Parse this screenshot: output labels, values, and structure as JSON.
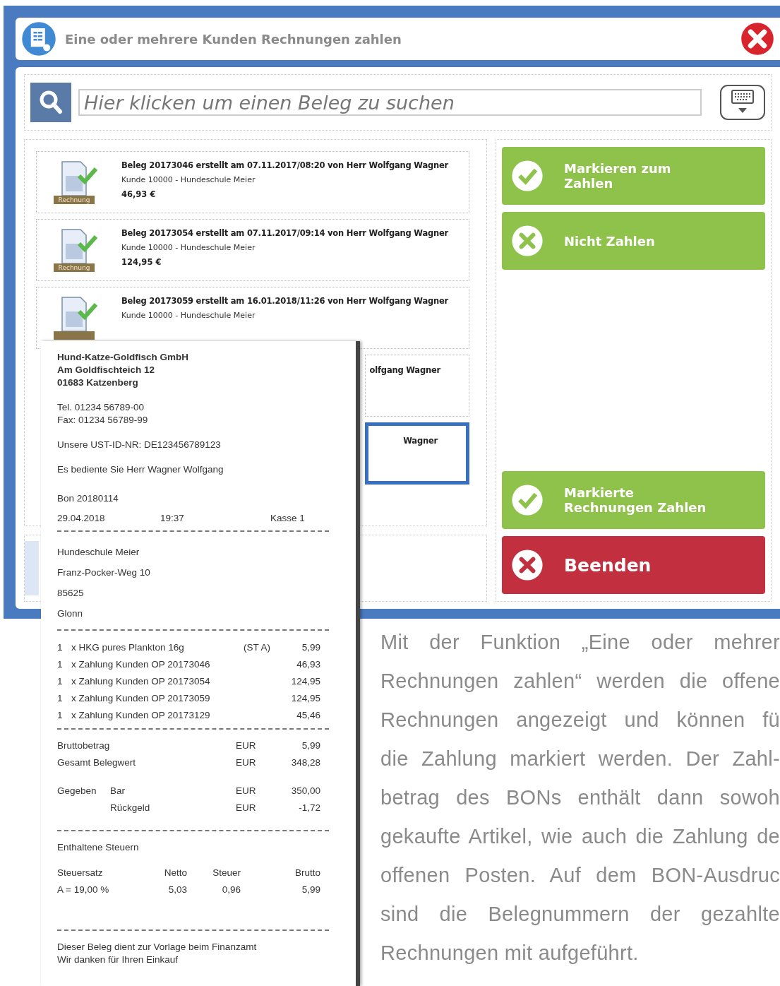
{
  "window": {
    "title": "Eine oder mehrere Kunden Rechnungen zahlen"
  },
  "search": {
    "placeholder": "Hier klicken um einen Beleg zu suchen"
  },
  "documents": [
    {
      "badge": "Rechnung",
      "title": "Beleg 20173046 erstellt am 07.11.2017/08:20 von Herr Wolfgang Wagner",
      "customer": "Kunde 10000 - Hundeschule Meier",
      "amount": "46,93 €",
      "selected": false,
      "kind": "full"
    },
    {
      "badge": "Rechnung",
      "title": "Beleg 20173054 erstellt am 07.11.2017/09:14 von Herr Wolfgang Wagner",
      "customer": "Kunde 10000 - Hundeschule Meier",
      "amount": "124,95 €",
      "selected": false,
      "kind": "full"
    },
    {
      "title": "Beleg 20173059 erstellt am 16.01.2018/11:26 von Herr Wolfgang Wagner",
      "customer": "Kunde 10000 - Hundeschule Meier",
      "selected": false,
      "kind": "full"
    },
    {
      "title": "olfgang Wagner",
      "selected": false,
      "kind": "partial"
    },
    {
      "title": "Wagner",
      "selected": true,
      "kind": "partial"
    }
  ],
  "actions_top": [
    {
      "kind": "mark",
      "label": "Markieren zum Zahlen"
    },
    {
      "kind": "unmark",
      "label": "Nicht Zahlen"
    }
  ],
  "actions_bottom": [
    {
      "kind": "pay",
      "label": "Markierte Rechnungen Zahlen"
    },
    {
      "kind": "quit",
      "label": "Beenden"
    }
  ],
  "receipt": [
    {
      "kind": "heading",
      "lines": [
        "Hund-Katze-Goldfisch GmbH",
        "Am Goldfischteich 12",
        "01683 Katzenberg"
      ]
    },
    {
      "kind": "text",
      "lines": [
        "Tel. 01234 56789-00",
        "Fax: 01234 56789-99"
      ]
    },
    {
      "kind": "text",
      "lines": [
        "Unsere UST-ID-NR: DE123456789123"
      ]
    },
    {
      "kind": "text",
      "lines": [
        "Es bediente Sie Herr Wagner Wolfgang"
      ]
    },
    {
      "kind": "spaced",
      "lines": [
        "Bon  20180114"
      ]
    },
    {
      "kind": "datetime",
      "date": "29.04.2018",
      "time": "19:37",
      "register": "Kasse 1"
    },
    {
      "kind": "divider"
    },
    {
      "kind": "spaced",
      "lines": [
        "Hundeschule Meier",
        "Franz-Pocker-Weg 10",
        "85625",
        "Glonn"
      ]
    },
    {
      "kind": "divider"
    },
    {
      "kind": "items",
      "rows": [
        {
          "qty": "1",
          "desc": "x HKG pures Plankton 16g",
          "tax": "(ST A)",
          "amount": "5,99"
        },
        {
          "qty": "1",
          "desc": "x Zahlung Kunden OP 20173046",
          "amount": "46,93"
        },
        {
          "qty": "1",
          "desc": "x Zahlung Kunden OP 20173054",
          "amount": "124,95"
        },
        {
          "qty": "1",
          "desc": "x Zahlung Kunden OP 20173059",
          "amount": "124,95"
        },
        {
          "qty": "1",
          "desc": "x Zahlung Kunden OP 20173129",
          "amount": "45,46"
        }
      ]
    },
    {
      "kind": "divider"
    },
    {
      "kind": "totals",
      "rows": [
        {
          "label": "Bruttobetrag",
          "currency": "EUR",
          "amount": "5,99"
        },
        {
          "label": "Gesamt Belegwert",
          "currency": "EUR",
          "amount": "348,28"
        }
      ]
    },
    {
      "kind": "totals",
      "rows": [
        {
          "label": "Gegeben",
          "sub": "Bar",
          "currency": "EUR",
          "amount": "350,00"
        },
        {
          "sub": "Rückgeld",
          "currency": "EUR",
          "amount": "-1,72"
        }
      ]
    },
    {
      "kind": "divider"
    },
    {
      "kind": "text",
      "lines": [
        "Enthaltene Steuern"
      ]
    },
    {
      "kind": "taxtable",
      "rows": [
        [
          "Steuersatz",
          "Netto",
          "Steuer",
          "Brutto"
        ],
        [
          "A = 19,00 %",
          "5,03",
          "0,96",
          "5,99"
        ]
      ]
    },
    {
      "kind": "divider"
    },
    {
      "kind": "text",
      "lines": [
        "Dieser Beleg dient zur Vorlage beim Finanzamt",
        "Wir danken für Ihren Einkauf"
      ]
    }
  ],
  "body_text": [
    "Mit der Funktion „Eine oder mehrer",
    "Rechnungen zahlen“ werden die offene",
    "Rechnungen angezeigt und können fü",
    "die Zahlung markiert werden. Der Zahl-",
    "betrag des BONs enthält dann sowoh",
    "gekaufte Artikel, wie auch die Zahlung de",
    "offenen Posten. Auf dem BON-Ausdruc",
    "sind die Belegnummern der gezahlte",
    "Rechnungen mit aufgeführt."
  ]
}
